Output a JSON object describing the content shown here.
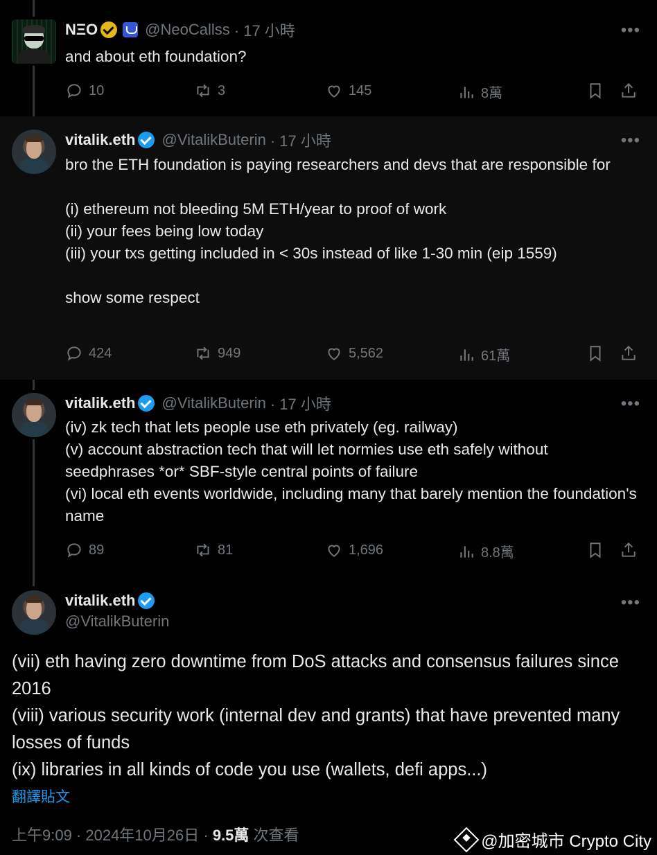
{
  "tweets": [
    {
      "name": "NΞO",
      "handle": "@NeoCallss",
      "time": "· 17 小時",
      "text": "and about eth foundation?",
      "replies": "10",
      "reposts": "3",
      "likes": "145",
      "views": "8萬"
    },
    {
      "name": "vitalik.eth",
      "handle": "@VitalikButerin",
      "time": "· 17 小時",
      "text": "bro the ETH foundation is paying researchers and devs that are responsible for\n\n(i) ethereum not bleeding 5M ETH/year to proof of work\n(ii) your fees being low today\n(iii) your txs getting included in < 30s instead of like 1-30 min (eip 1559)\n\nshow some respect",
      "replies": "424",
      "reposts": "949",
      "likes": "5,562",
      "views": "61萬"
    },
    {
      "name": "vitalik.eth",
      "handle": "@VitalikButerin",
      "time": "· 17 小時",
      "text": "(iv) zk tech that lets people use eth privately (eg. railway)\n(v) account abstraction tech that will let normies use eth safely without seedphrases *or* SBF-style central points of failure\n(vi) local eth events worldwide, including many that barely mention the foundation's name",
      "replies": "89",
      "reposts": "81",
      "likes": "1,696",
      "views": "8.8萬"
    }
  ],
  "main_tweet": {
    "name": "vitalik.eth",
    "handle": "@VitalikButerin",
    "text": "(vii) eth having zero downtime from DoS attacks and consensus failures since 2016\n(viii) various security work (internal dev and grants) that have prevented many losses of funds\n(ix) libraries in all kinds of code you use (wallets, defi apps...)",
    "translate_label": "翻譯貼文",
    "timestamp": "上午9:09 · 2024年10月26日 ·",
    "views_count": "9.5萬",
    "views_label": "次查看"
  },
  "more_label": "•••",
  "watermark": "@加密城市 Crypto City",
  "colors": {
    "background": "#000000",
    "text": "#e7e9ea",
    "muted": "#71767b",
    "accent": "#1d9bf0",
    "gold_badge": "#e2b719"
  },
  "icons": [
    "reply-icon",
    "repost-icon",
    "like-icon",
    "views-icon",
    "bookmark-icon",
    "share-icon",
    "verified-icon",
    "affiliate-icon",
    "more-icon"
  ]
}
